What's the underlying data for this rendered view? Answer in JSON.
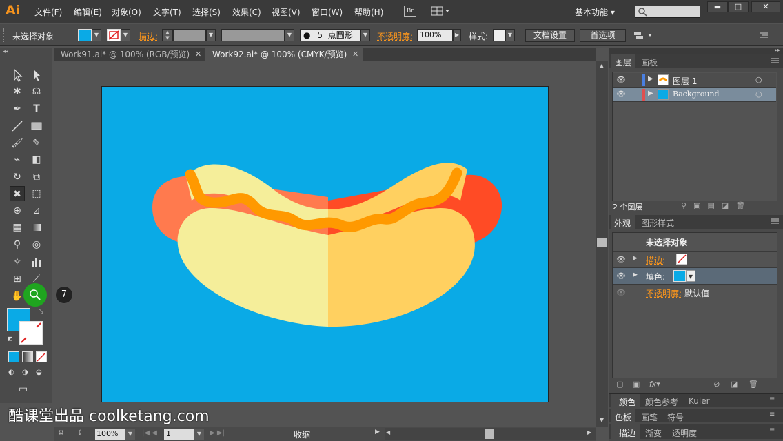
{
  "app": {
    "logo": "Ai",
    "br_button": "Br",
    "workspace": "基本功能 ▾"
  },
  "menu": [
    "文件(F)",
    "编辑(E)",
    "对象(O)",
    "文字(T)",
    "选择(S)",
    "效果(C)",
    "视图(V)",
    "窗口(W)",
    "帮助(H)"
  ],
  "window_controls": {
    "minimize": "▬",
    "maximize": "□",
    "close": "✕"
  },
  "control_bar": {
    "selection_state": "未选择对象",
    "stroke_label": "描边:",
    "brush_size": "5",
    "brush_shape": "点圆形",
    "opacity_label": "不透明度:",
    "opacity_value": "100%",
    "style_label": "样式:",
    "doc_settings": "文档设置",
    "preferences": "首选项"
  },
  "doc_tabs": [
    {
      "label": "Work91.ai* @ 100% (RGB/预览)",
      "active": false
    },
    {
      "label": "Work92.ai* @ 100% (CMYK/预览)",
      "active": true
    }
  ],
  "status_bar": {
    "zoom": "100%",
    "page": "1",
    "status_text": "收缩"
  },
  "layers_panel": {
    "tabs": [
      "图层",
      "画板"
    ],
    "layers": [
      {
        "name": "图层 1",
        "color": "#4a7fe0"
      },
      {
        "name": "Background",
        "color": "#e05050"
      }
    ],
    "count": "2 个图层"
  },
  "appearance_panel": {
    "tabs": [
      "外观",
      "图形样式"
    ],
    "title": "未选择对象",
    "stroke_label": "描边:",
    "fill_label": "填色:",
    "opacity_label": "不透明度:",
    "opacity_value": "默认值"
  },
  "bottom_panels": {
    "color_tabs": [
      "颜色",
      "颜色参考",
      "Kuler"
    ],
    "swatch_tabs": [
      "色板",
      "画笔",
      "符号"
    ],
    "stroke_tabs": [
      "描边",
      "渐变",
      "透明度"
    ]
  },
  "overlay": {
    "step_number": "7",
    "watermark": "酷课堂出品 coolketang.com"
  },
  "colors": {
    "artboard": "#0aaae6",
    "fill_swatch": "#0aaae6",
    "bun_light": "#f5ee9a",
    "bun_dark": "#ffd060",
    "sausage_light": "#ff7a4e",
    "sausage_dark": "#ff4b25",
    "mustard": "#ff9900",
    "accent_orange": "#f7941d"
  }
}
